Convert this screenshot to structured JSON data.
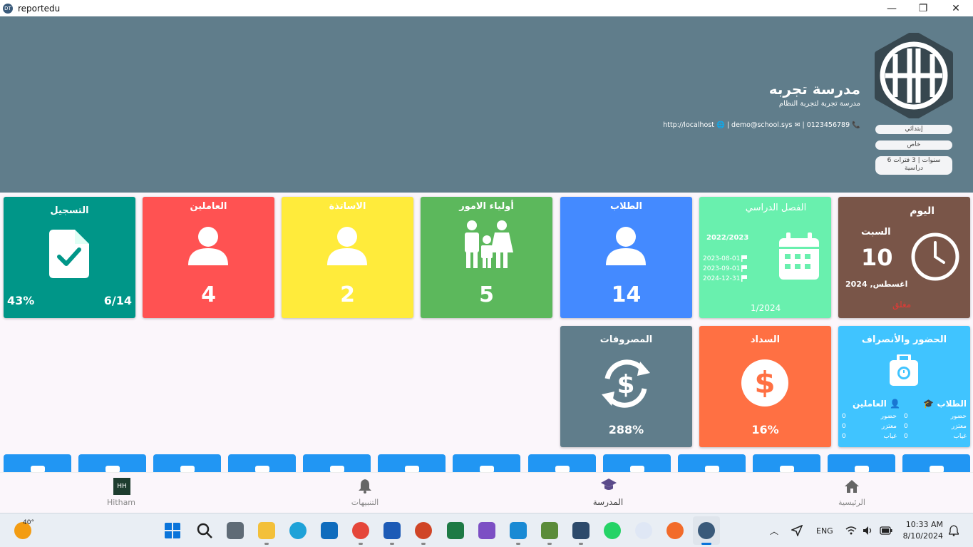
{
  "window": {
    "title": "reportedu",
    "app_icon_text": "DT"
  },
  "header": {
    "logo_text": "HH",
    "school_name": "مدرسة تجربه",
    "school_subtitle": "مدرسة تجربة لتجربة النظام",
    "contact": "http://localhost 🌐 | demo@school.sys ✉ | 0123456789 📞",
    "pills": [
      "إبتدائي",
      "خاص",
      "6 سنوات | 3 فترات دراسية"
    ]
  },
  "tiles": {
    "today": {
      "title": "اليوم",
      "weekday": "السبت",
      "day": "10",
      "month_year": "اغسطس, 2024",
      "status": "مغلق",
      "color": "#795548"
    },
    "semester": {
      "title": "الفصل الدراسي",
      "year": "2022/2023",
      "dates": [
        "2023-08-01",
        "2023-09-01",
        "2024-12-31"
      ],
      "term": "1/2024",
      "color": "#69f0ae"
    },
    "students": {
      "title": "الطلاب",
      "count": "14",
      "color": "#448aff"
    },
    "guardians": {
      "title": "أولياء الامور",
      "count": "5",
      "color": "#5cb85c"
    },
    "teachers": {
      "title": "الاساتذة",
      "count": "2",
      "color": "#ffeb3b"
    },
    "workers": {
      "title": "العاملين",
      "count": "4",
      "color": "#ff5252"
    },
    "registration": {
      "title": "التسجيل",
      "ratio": "6/14",
      "percent": "43%",
      "color": "#009688"
    },
    "attendance": {
      "title": "الحضور والأنصراف",
      "students_label": "الطلاب",
      "workers_label": "العاملين",
      "rows": [
        {
          "label": "حضور",
          "students": "0",
          "workers_label": "حضور",
          "workers": "0"
        },
        {
          "label": "معتزر",
          "students": "0",
          "workers_label": "معتزر",
          "workers": "0"
        },
        {
          "label": "غياب",
          "students": "0",
          "workers_label": "غياب",
          "workers": "0"
        }
      ],
      "color": "#40c4ff"
    },
    "payments": {
      "title": "السداد",
      "percent": "16%",
      "color": "#ff7043"
    },
    "expenses": {
      "title": "المصروفات",
      "percent": "288%",
      "color": "#607d8b"
    }
  },
  "bottom_nav": {
    "home": "الرئيسية",
    "school": "المدرسة",
    "notifications": "التنبيهات",
    "user": "Hitham",
    "user_avatar": "HH"
  },
  "taskbar": {
    "weather": "40°",
    "language": "ENG",
    "time": "10:33 AM",
    "date": "8/10/2024"
  }
}
